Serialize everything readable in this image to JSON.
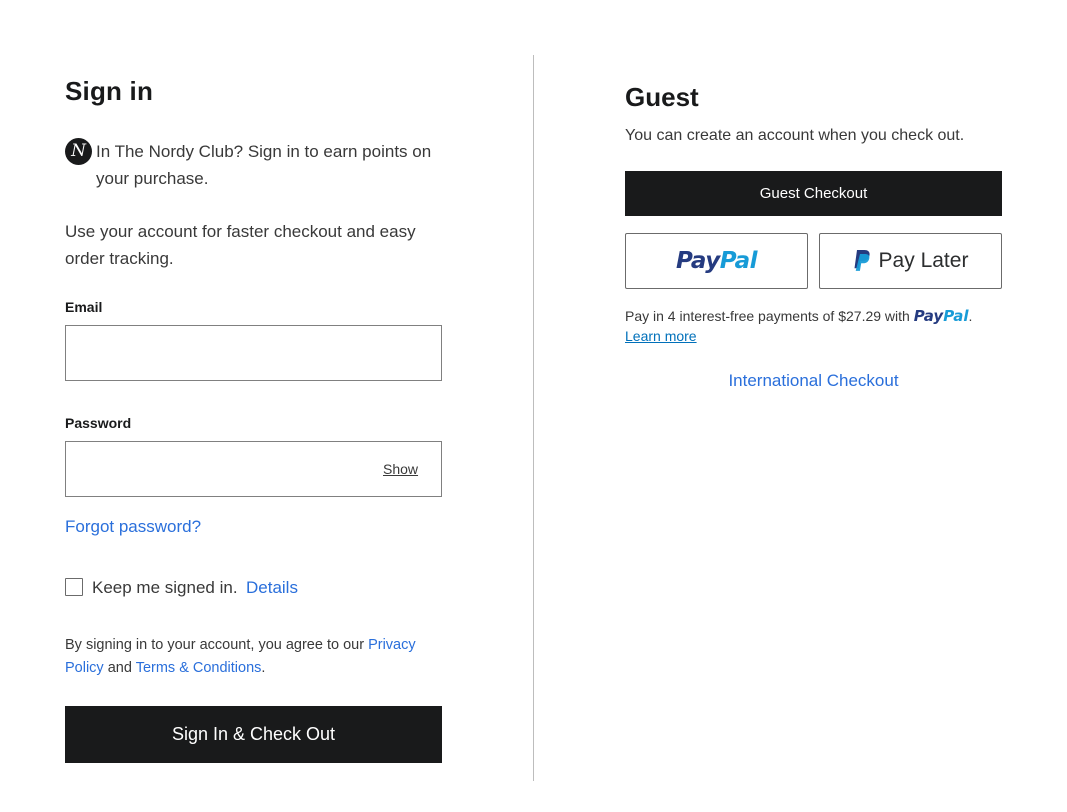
{
  "signin": {
    "title": "Sign in",
    "nordy_logo_letter": "N",
    "nordy_text": "In The Nordy Club? Sign in to earn points on your purchase.",
    "intro": "Use your account for faster checkout and easy order tracking.",
    "email_label": "Email",
    "email_value": "",
    "password_label": "Password",
    "password_value": "",
    "show_label": "Show",
    "forgot_label": "Forgot password?",
    "keep_signed_in_label": "Keep me signed in.",
    "keep_signed_in_checked": false,
    "details_label": "Details",
    "legal_prefix": "By signing in to your account, you agree to our ",
    "privacy_label": "Privacy Policy",
    "legal_and": " and ",
    "terms_label": "Terms & Conditions",
    "legal_suffix": ".",
    "submit_label": "Sign In & Check Out"
  },
  "guest": {
    "title": "Guest",
    "subtitle": "You can create an account when you check out.",
    "checkout_label": "Guest Checkout",
    "paypal_pay": "Pay",
    "paypal_pal": "Pal",
    "paylater_label": "Pay Later",
    "installments_text": "Pay in 4 interest-free payments of $27.29 with ",
    "installments_brand_pay": "Pay",
    "installments_brand_pal": "Pal",
    "installments_period": ".",
    "learn_more_label": "Learn more",
    "international_label": "International Checkout"
  },
  "colors": {
    "primary_button": "#191a1b",
    "link": "#2a6fdb",
    "paypal_dark": "#253b80",
    "paypal_light": "#179bd7"
  }
}
